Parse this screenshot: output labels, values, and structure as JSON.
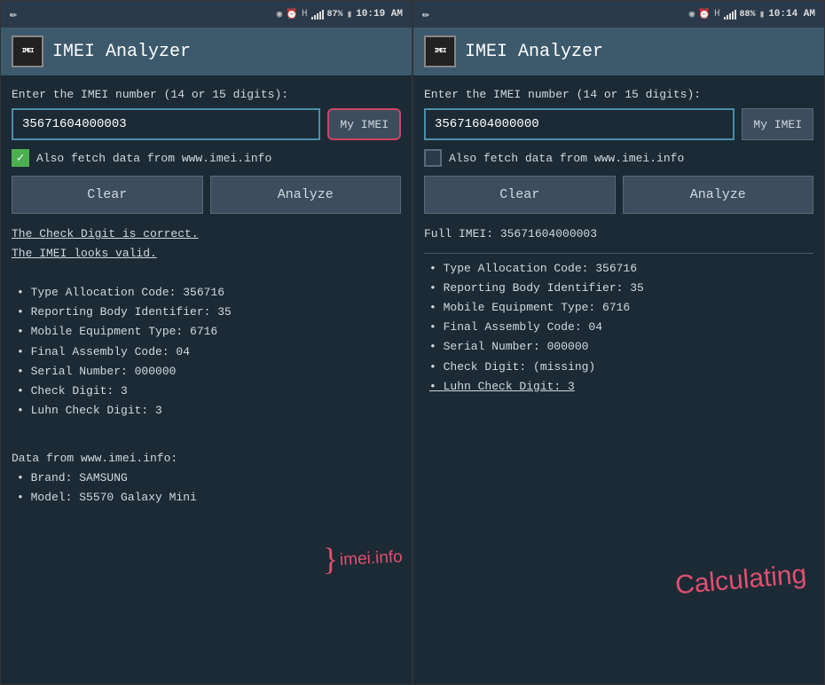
{
  "screen1": {
    "statusBar": {
      "battery": "87%",
      "time": "10:19 AM",
      "pencil": "✏",
      "eye": "👁",
      "alarm": "⏰",
      "signal": "H"
    },
    "header": {
      "title": "IMEI Analyzer",
      "logo": "IMEI"
    },
    "label": "Enter the IMEI number (14 or 15 digits):",
    "inputValue": "35671604000003",
    "myImeiLabel": "My IMEI",
    "checkboxChecked": true,
    "checkboxLabel": "Also fetch data from www.imei.info",
    "clearLabel": "Clear",
    "analyzeLabel": "Analyze",
    "results": {
      "line1": "The Check Digit is correct.",
      "line2": "The IMEI looks valid.",
      "items": [
        "• Type Allocation Code: 356716",
        "• Reporting Body Identifier: 35",
        "• Mobile Equipment Type: 6716",
        "• Final Assembly Code: 04",
        "• Serial Number: 000000",
        "• Check Digit: 3",
        "• Luhn Check Digit: 3"
      ],
      "dataTitle": "Data from www.imei.info:",
      "dataItems": [
        "• Brand: SAMSUNG",
        "• Model: S5570 Galaxy Mini"
      ]
    },
    "annotation": "imei.info"
  },
  "screen2": {
    "statusBar": {
      "battery": "88%",
      "time": "10:14 AM",
      "pencil": "✏",
      "eye": "👁",
      "alarm": "⏰",
      "signal": "H"
    },
    "header": {
      "title": "IMEI Analyzer",
      "logo": "IMEI"
    },
    "label": "Enter the IMEI number (14 or 15 digits):",
    "inputValue": "35671604000000",
    "myImeiLabel": "My IMEI",
    "checkboxChecked": false,
    "checkboxLabel": "Also fetch data from www.imei.info",
    "clearLabel": "Clear",
    "analyzeLabel": "Analyze",
    "results": {
      "fullImei": "Full IMEI: 35671604000003",
      "items": [
        "• Type Allocation Code: 356716",
        "• Reporting Body Identifier: 35",
        "• Mobile Equipment Type: 6716",
        "• Final Assembly Code: 04",
        "• Serial Number: 000000",
        "• Check Digit: (missing)",
        "• Luhn Check Digit: 3"
      ]
    },
    "annotation": "Calculating"
  }
}
